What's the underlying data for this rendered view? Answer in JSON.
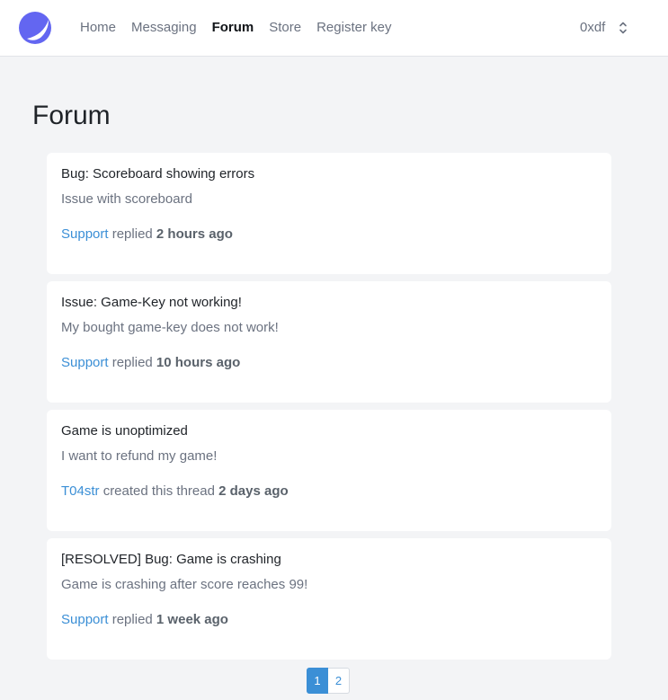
{
  "nav": {
    "items": [
      {
        "label": "Home",
        "active": false
      },
      {
        "label": "Messaging",
        "active": false
      },
      {
        "label": "Forum",
        "active": true
      },
      {
        "label": "Store",
        "active": false
      },
      {
        "label": "Register key",
        "active": false
      }
    ],
    "logo_icon": "crescent-logo-icon",
    "accent_color": "#6366f1"
  },
  "user": {
    "name": "0xdf",
    "menu_icon": "chevron-up-down-icon"
  },
  "page": {
    "title": "Forum"
  },
  "threads": [
    {
      "title": "Bug: Scoreboard showing errors",
      "description": "Issue with scoreboard",
      "author": "Support",
      "action": "replied",
      "time": "2 hours ago"
    },
    {
      "title": "Issue: Game-Key not working!",
      "description": "My bought game-key does not work!",
      "author": "Support",
      "action": "replied",
      "time": "10 hours ago"
    },
    {
      "title": "Game is unoptimized",
      "description": "I want to refund my game!",
      "author": "T04str",
      "action": "created this thread",
      "time": "2 days ago"
    },
    {
      "title": "[RESOLVED] Bug: Game is crashing",
      "description": "Game is crashing after score reaches 99!",
      "author": "Support",
      "action": "replied",
      "time": "1 week ago"
    }
  ],
  "pagination": {
    "pages": [
      "1",
      "2"
    ],
    "current": "1",
    "active_color": "#3b8fd6"
  }
}
